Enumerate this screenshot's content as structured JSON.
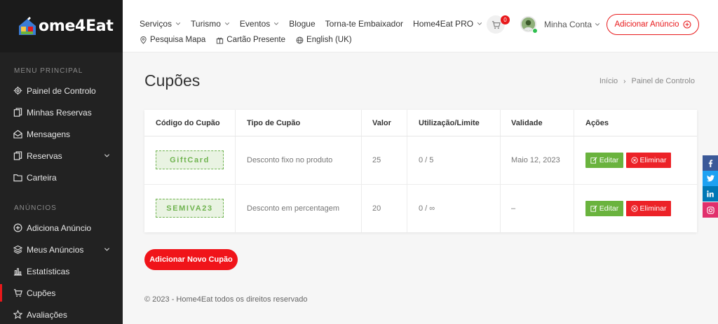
{
  "brand": {
    "name": "ome4Eat"
  },
  "sidebar": {
    "section1": "MENU PRINCIPAL",
    "items1": [
      {
        "label": "Painel de Controlo"
      },
      {
        "label": "Minhas Reservas"
      },
      {
        "label": "Mensagens"
      },
      {
        "label": "Reservas"
      },
      {
        "label": "Carteira"
      }
    ],
    "section2": "ANÚNCIOS",
    "items2": [
      {
        "label": "Adiciona Anúncio"
      },
      {
        "label": "Meus Anúncios"
      },
      {
        "label": "Estatísticas"
      },
      {
        "label": "Cupões"
      },
      {
        "label": "Avaliações"
      }
    ]
  },
  "header": {
    "nav1": [
      {
        "label": "Serviços"
      },
      {
        "label": "Turismo"
      },
      {
        "label": "Eventos"
      },
      {
        "label": "Blogue"
      },
      {
        "label": "Torna-te Embaixador"
      },
      {
        "label": "Home4Eat PRO"
      }
    ],
    "nav2": [
      {
        "label": "Pesquisa Mapa"
      },
      {
        "label": "Cartão Presente"
      },
      {
        "label": "English (UK)"
      }
    ],
    "cart_count": "0",
    "account_label": "Minha Conta",
    "add_ad_label": "Adicionar Anúncio"
  },
  "page": {
    "title": "Cupões",
    "breadcrumb": [
      "Início",
      "Painel de Controlo"
    ]
  },
  "table": {
    "headers": [
      "Código do Cupão",
      "Tipo de Cupão",
      "Valor",
      "Utilização/Limite",
      "Validade",
      "Ações"
    ],
    "rows": [
      {
        "code": "GiftCard",
        "type": "Desconto fixo no produto",
        "value": "25",
        "usage": "0 / 5",
        "validity": "Maio 12, 2023"
      },
      {
        "code": "SEMIVA23",
        "type": "Desconto em percentagem",
        "value": "20",
        "usage": "0 / ∞",
        "validity": "–"
      }
    ],
    "edit_label": "Editar",
    "delete_label": "Eliminar"
  },
  "actions": {
    "new_coupon_label": "Adicionar Novo Cupão"
  },
  "footer": {
    "text": "© 2023 - Home4Eat todos os direitos reservado"
  },
  "social": [
    {
      "glyph": "f",
      "color": "#3b5998"
    },
    {
      "glyph": "t",
      "color": "#1da1f2"
    },
    {
      "glyph": "in",
      "color": "#0077b5"
    },
    {
      "glyph": "ig",
      "color": "#e1306c"
    }
  ],
  "colors": {
    "accent": "#e8191b",
    "success": "#6ab33e",
    "sidebar_bg": "#222222"
  }
}
